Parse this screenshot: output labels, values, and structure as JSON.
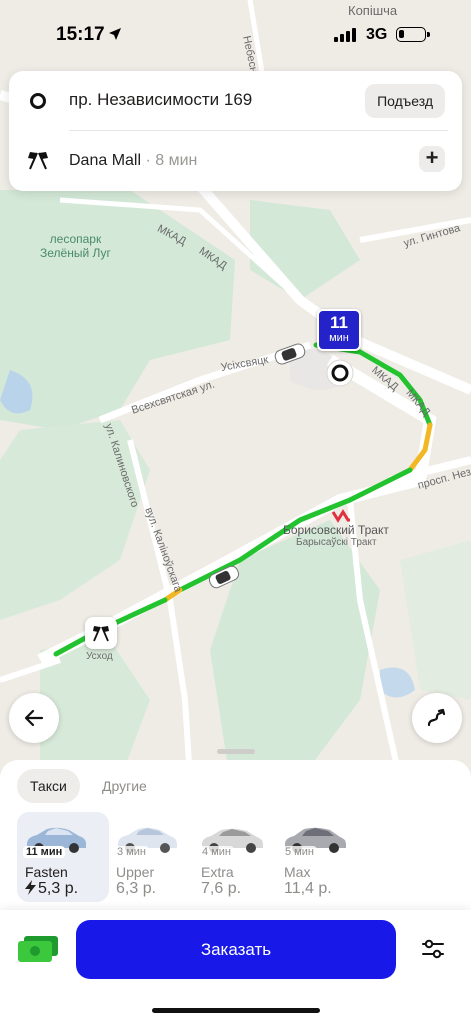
{
  "status_bar": {
    "time": "15:17",
    "network": "3G"
  },
  "address": {
    "from": "пр. Независимости 169",
    "entrance_label": "Подъезд",
    "to_name": "Dana Mall",
    "to_eta": " · 8 мин"
  },
  "map": {
    "labels": {
      "kopishcha": "Копiшча",
      "nebesnaya": "Небесн",
      "mkad1": "МКАД",
      "mkad2": "МКАД",
      "gintova": "ул. Гинтова",
      "park": "лесопарк\nЗелёный Луг",
      "vsekhsvyatskaya": "Всехсвятская ул.",
      "usikhsviats": "Усiхсвяцк",
      "mkad3": "МКАД",
      "mkad4": "МКАД",
      "kalinovskogo": "ул. Калиновского",
      "kalinouskaga": "вул. Калiноўскага",
      "prosp": "просп. Незав",
      "metro_station": "Борисовский Тракт",
      "metro_station_by": "Барысаўскi Тракт",
      "uskhod": "Усход"
    },
    "eta_marker": {
      "num": "11",
      "unit": "мин"
    }
  },
  "sheet": {
    "tabs": [
      "Такси",
      "Другие"
    ],
    "tariffs": [
      {
        "name": "Fasten",
        "time": "11 мин",
        "price": "5,3 р.",
        "selected": true
      },
      {
        "name": "Upper",
        "time": "3 мин",
        "price": "6,3 р."
      },
      {
        "name": "Extra",
        "time": "4 мин",
        "price": "7,6 р."
      },
      {
        "name": "Max",
        "time": "5 мин",
        "price": "11,4 р."
      }
    ],
    "order_label": "Заказать"
  },
  "colors": {
    "accent": "#1818e8",
    "route_green": "#22c32e",
    "route_yellow": "#f2b824",
    "marker_blue": "#2323c9"
  }
}
